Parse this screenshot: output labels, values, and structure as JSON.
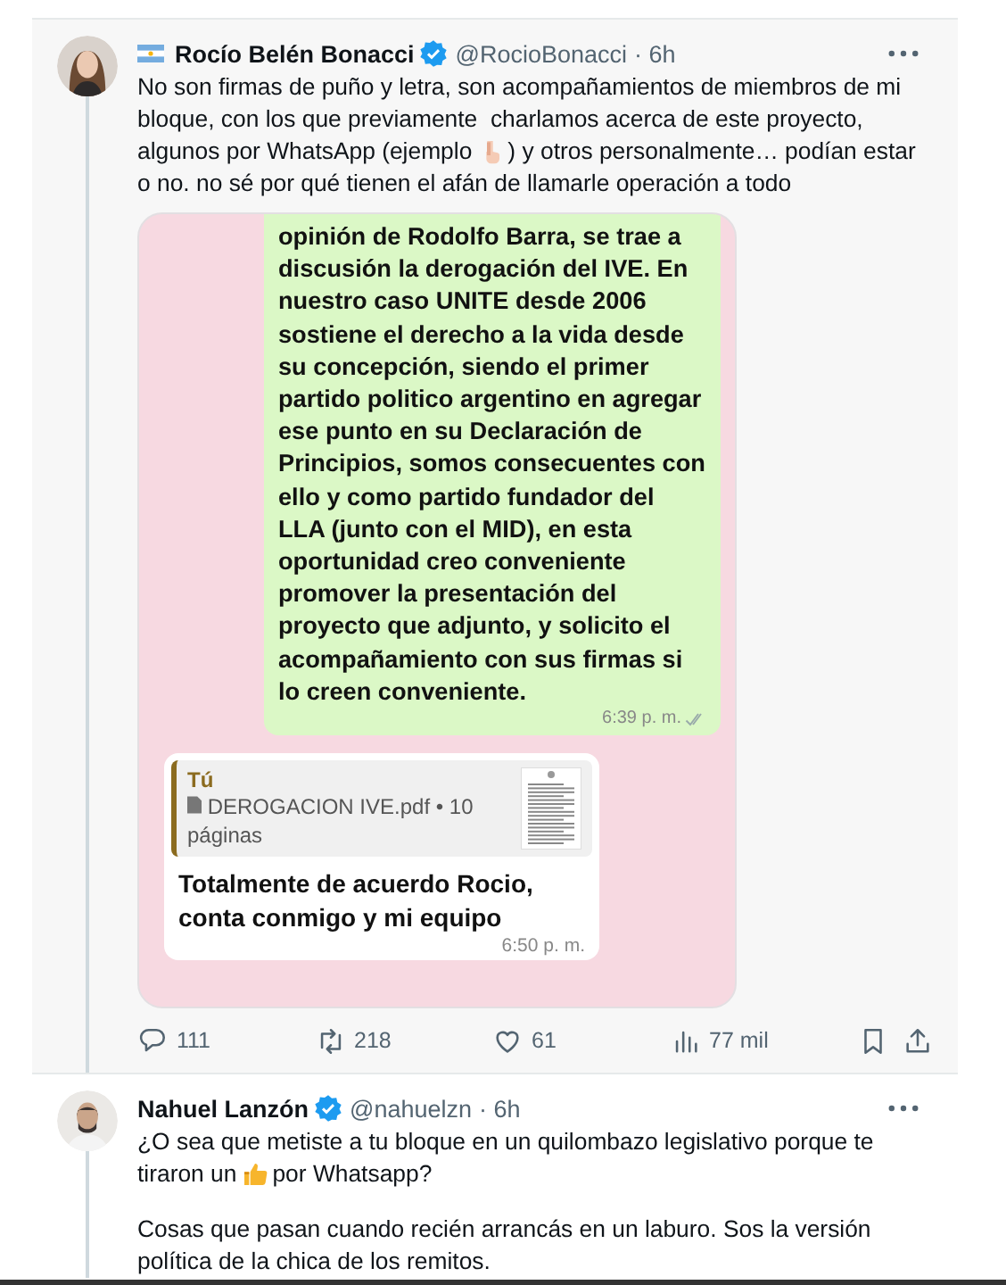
{
  "tweets": [
    {
      "name": "Rocío Belén Bonacci",
      "verified": true,
      "flag": true,
      "handle": "@RocioBonacci",
      "time": "· 6h",
      "highlighted": true,
      "body": [
        [
          [
            {
              "kind": "text",
              "text": "No son firmas de puño y letra, son acompañamientos de miembros de mi"
            }
          ],
          [
            {
              "kind": "text",
              "text": "bloque, con los que previamente  charlamos acerca de este proyecto,"
            }
          ],
          [
            {
              "kind": "text",
              "text": "algunos por WhatsApp (ejemplo"
            },
            {
              "kind": "point-down"
            },
            {
              "kind": "text",
              "text": ") y otros personalmente… podían estar"
            }
          ],
          [
            {
              "kind": "text",
              "text": "o no. no sé por qué tienen el afán de llamarle operación a todo"
            }
          ]
        ]
      ],
      "chat": [
        {
          "kind": "outgoing",
          "text": "opinión de Rodolfo Barra, se trae a discusión la derogación del IVE. En nuestro caso UNITE desde 2006 sostiene el derecho a la vida desde su concepción, siendo el primer partido politico argentino en agregar ese punto en su Declaración de Principios, somos consecuentes con ello y como partido fundador del LLA (junto con el MID), en esta oportunidad creo conveniente promover la presentación del proyecto que adjunto, y solicito el acompañamiento con sus firmas si lo creen conveniente.",
          "time": "6:39 p. m."
        },
        {
          "kind": "incoming",
          "quote_author": "Tú",
          "quote_file": "DEROGACION IVE.pdf • 10 páginas",
          "text": "Totalmente de acuerdo Rocio, conta conmigo y mi equipo",
          "time": "6:50 p. m."
        }
      ],
      "stats": [
        {
          "kind": "reply",
          "count": "111"
        },
        {
          "kind": "retweet",
          "count": "218"
        },
        {
          "kind": "like",
          "count": "61"
        },
        {
          "kind": "views",
          "count": "77 mil"
        },
        {
          "kind": "bookmark"
        },
        {
          "kind": "share"
        }
      ]
    },
    {
      "name": "Nahuel Lanzón",
      "verified": true,
      "flag": false,
      "handle": "@nahuelzn",
      "time": "· 6h",
      "highlighted": false,
      "body": [
        [
          [
            {
              "kind": "text",
              "text": "¿O sea que metiste a tu bloque en un quilombazo legislativo porque te"
            }
          ],
          [
            {
              "kind": "text",
              "text": "tiraron un"
            },
            {
              "kind": "thumbs-up"
            },
            {
              "kind": "text",
              "text": "por Whatsapp?"
            }
          ]
        ],
        [
          [
            {
              "kind": "text",
              "text": "Cosas que pasan cuando recién arrancás en un laburo. Sos la versión"
            }
          ],
          [
            {
              "kind": "text",
              "text": "política de la chica de los remitos."
            }
          ]
        ]
      ]
    }
  ]
}
